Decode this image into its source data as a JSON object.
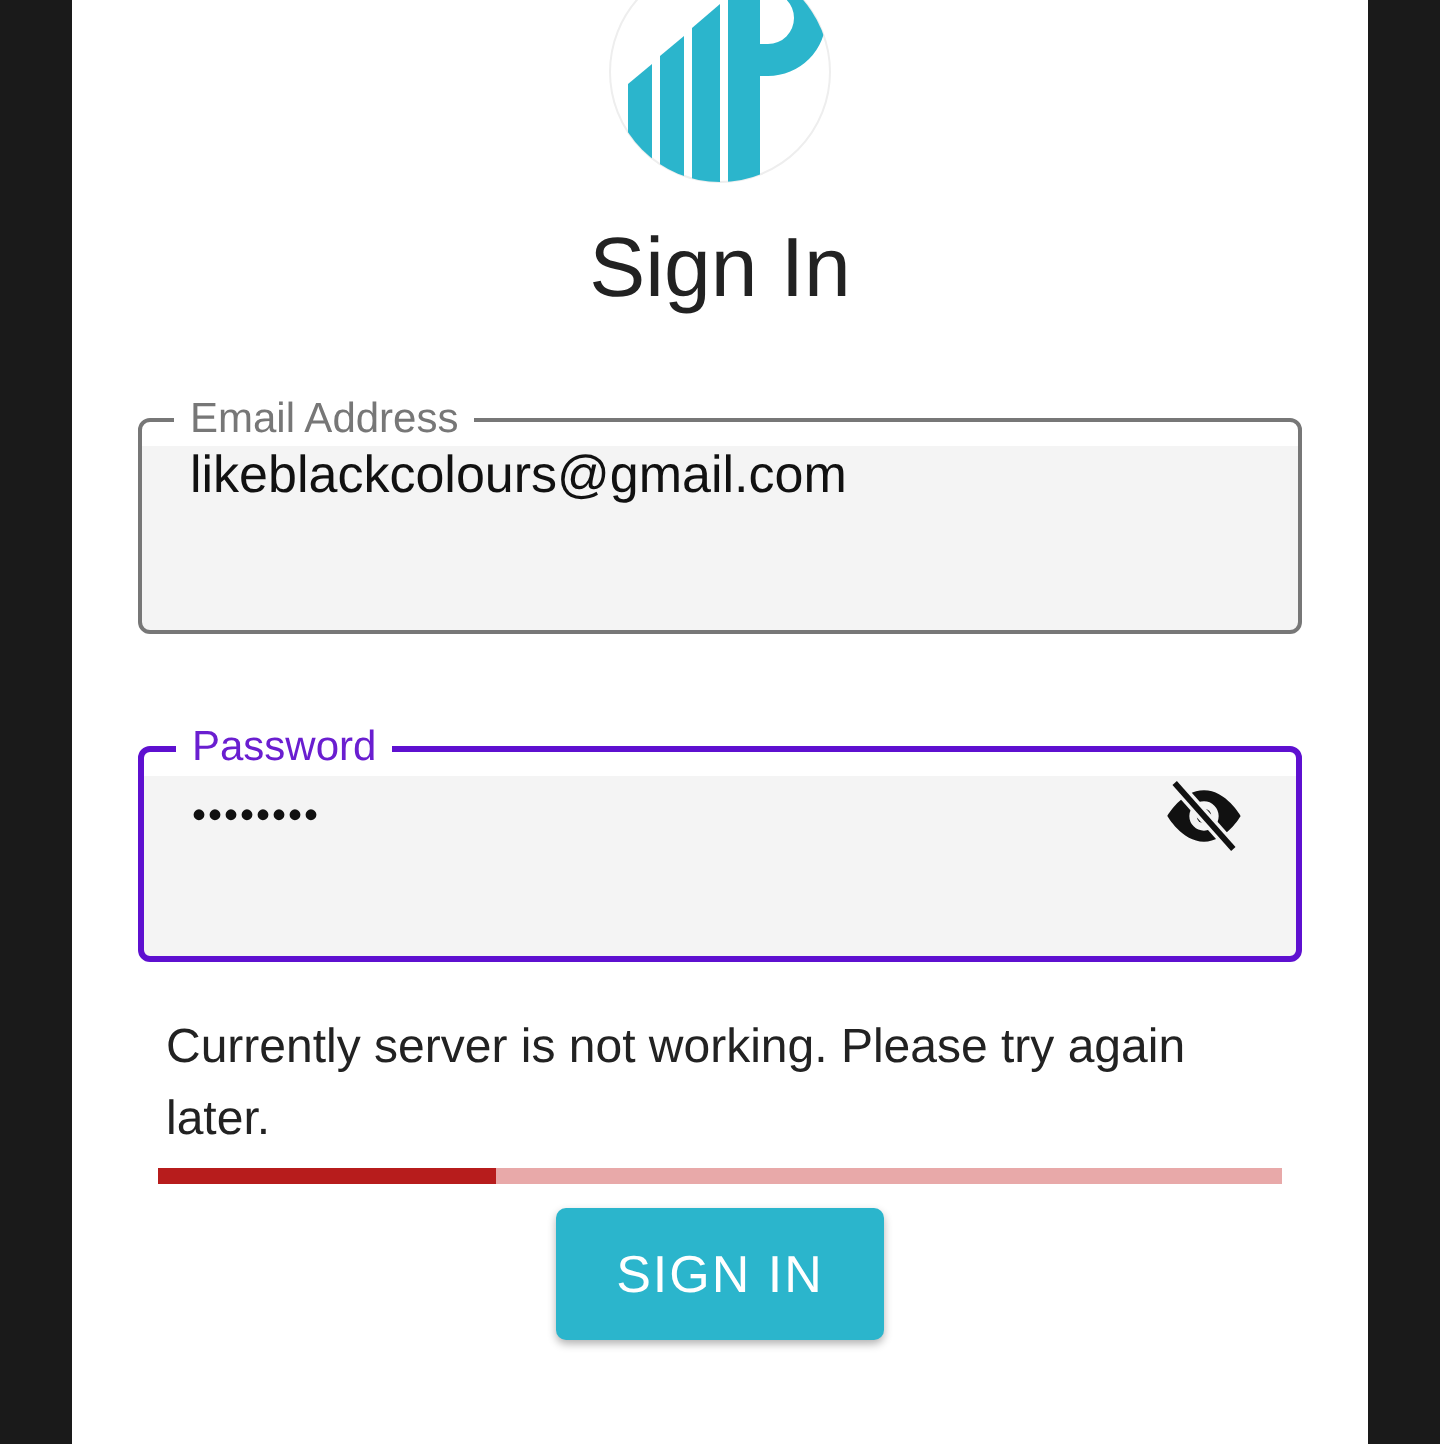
{
  "title": "Sign In",
  "fields": [
    {
      "kind": "email",
      "label": "Email Address",
      "value": "likeblackcolours@gmail.com",
      "focused": false
    },
    {
      "kind": "password",
      "label": "Password",
      "value": "••••••••",
      "focused": true,
      "password_visible": false
    }
  ],
  "error": {
    "message": "Currently server is not working. Please try again later.",
    "level": 0.3
  },
  "button": "SIGN IN"
}
